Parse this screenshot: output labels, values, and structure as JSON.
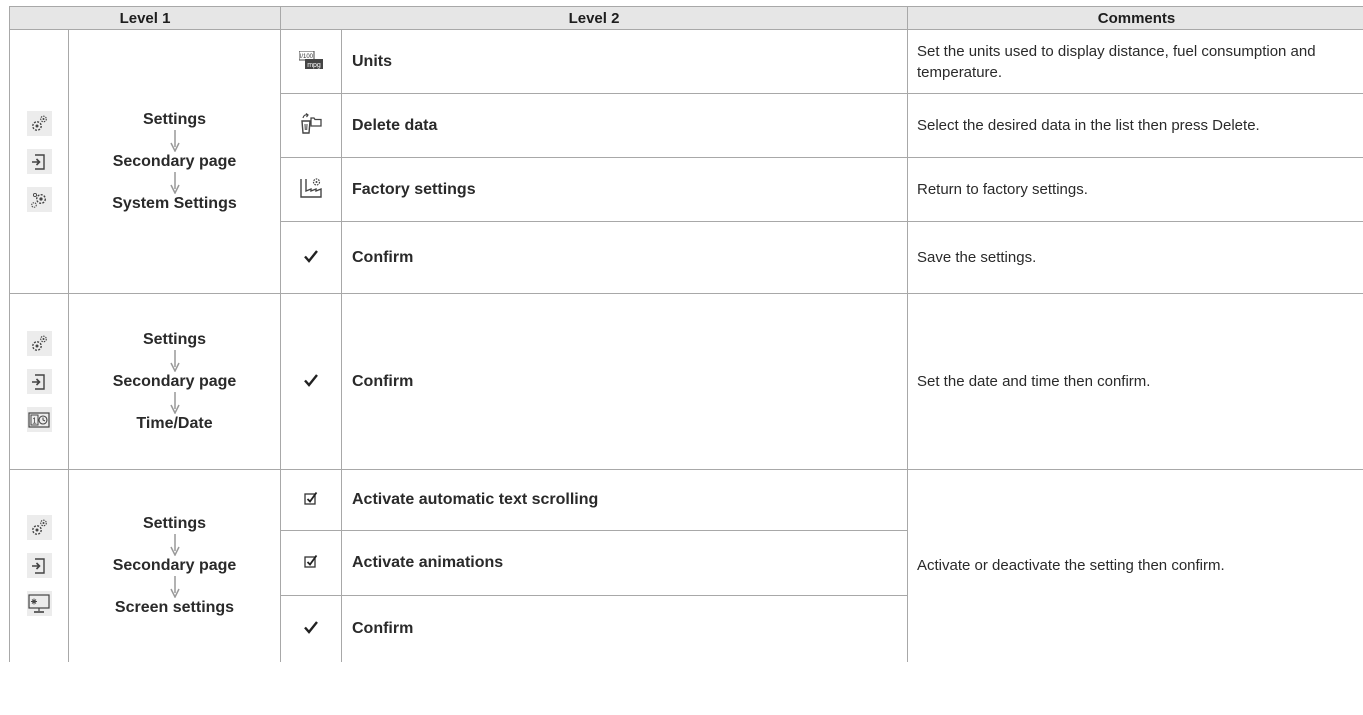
{
  "headers": {
    "level1": "Level 1",
    "level2": "Level 2",
    "comments": "Comments"
  },
  "sections": [
    {
      "level1_icons": [
        "settings-gear-icon",
        "secondary-page-icon",
        "system-settings-icon"
      ],
      "path": [
        "Settings",
        "Secondary page",
        "System Settings"
      ],
      "rows": [
        {
          "icon": "units-icon",
          "label": "Units",
          "comment": "Set the units used to display distance, fuel consumption and temperature."
        },
        {
          "icon": "delete-data-icon",
          "label": "Delete data",
          "comment": "Select the desired data in the list then press Delete."
        },
        {
          "icon": "factory-settings-icon",
          "label": "Factory settings",
          "comment": "Return to factory settings."
        },
        {
          "icon": "checkmark-icon",
          "label": "Confirm",
          "comment": "Save the settings."
        }
      ]
    },
    {
      "level1_icons": [
        "settings-gear-icon",
        "secondary-page-icon",
        "time-date-icon"
      ],
      "path": [
        "Settings",
        "Secondary page",
        "Time/Date"
      ],
      "rows": [
        {
          "icon": "checkmark-icon",
          "label": "Confirm",
          "comment": "Set the date and time then confirm."
        }
      ]
    },
    {
      "level1_icons": [
        "settings-gear-icon",
        "secondary-page-icon",
        "screen-settings-icon"
      ],
      "path": [
        "Settings",
        "Secondary page",
        "Screen settings"
      ],
      "rows": [
        {
          "icon": "checkbox-icon",
          "label": "Activate automatic text scrolling"
        },
        {
          "icon": "checkbox-icon",
          "label": "Activate animations"
        },
        {
          "icon": "checkmark-icon",
          "label": "Confirm"
        }
      ],
      "comment": "Activate or deactivate the setting then confirm."
    }
  ],
  "icon_labels": {
    "units_top": "l/100",
    "units_bottom": "mpg",
    "time_date_day": "1"
  }
}
